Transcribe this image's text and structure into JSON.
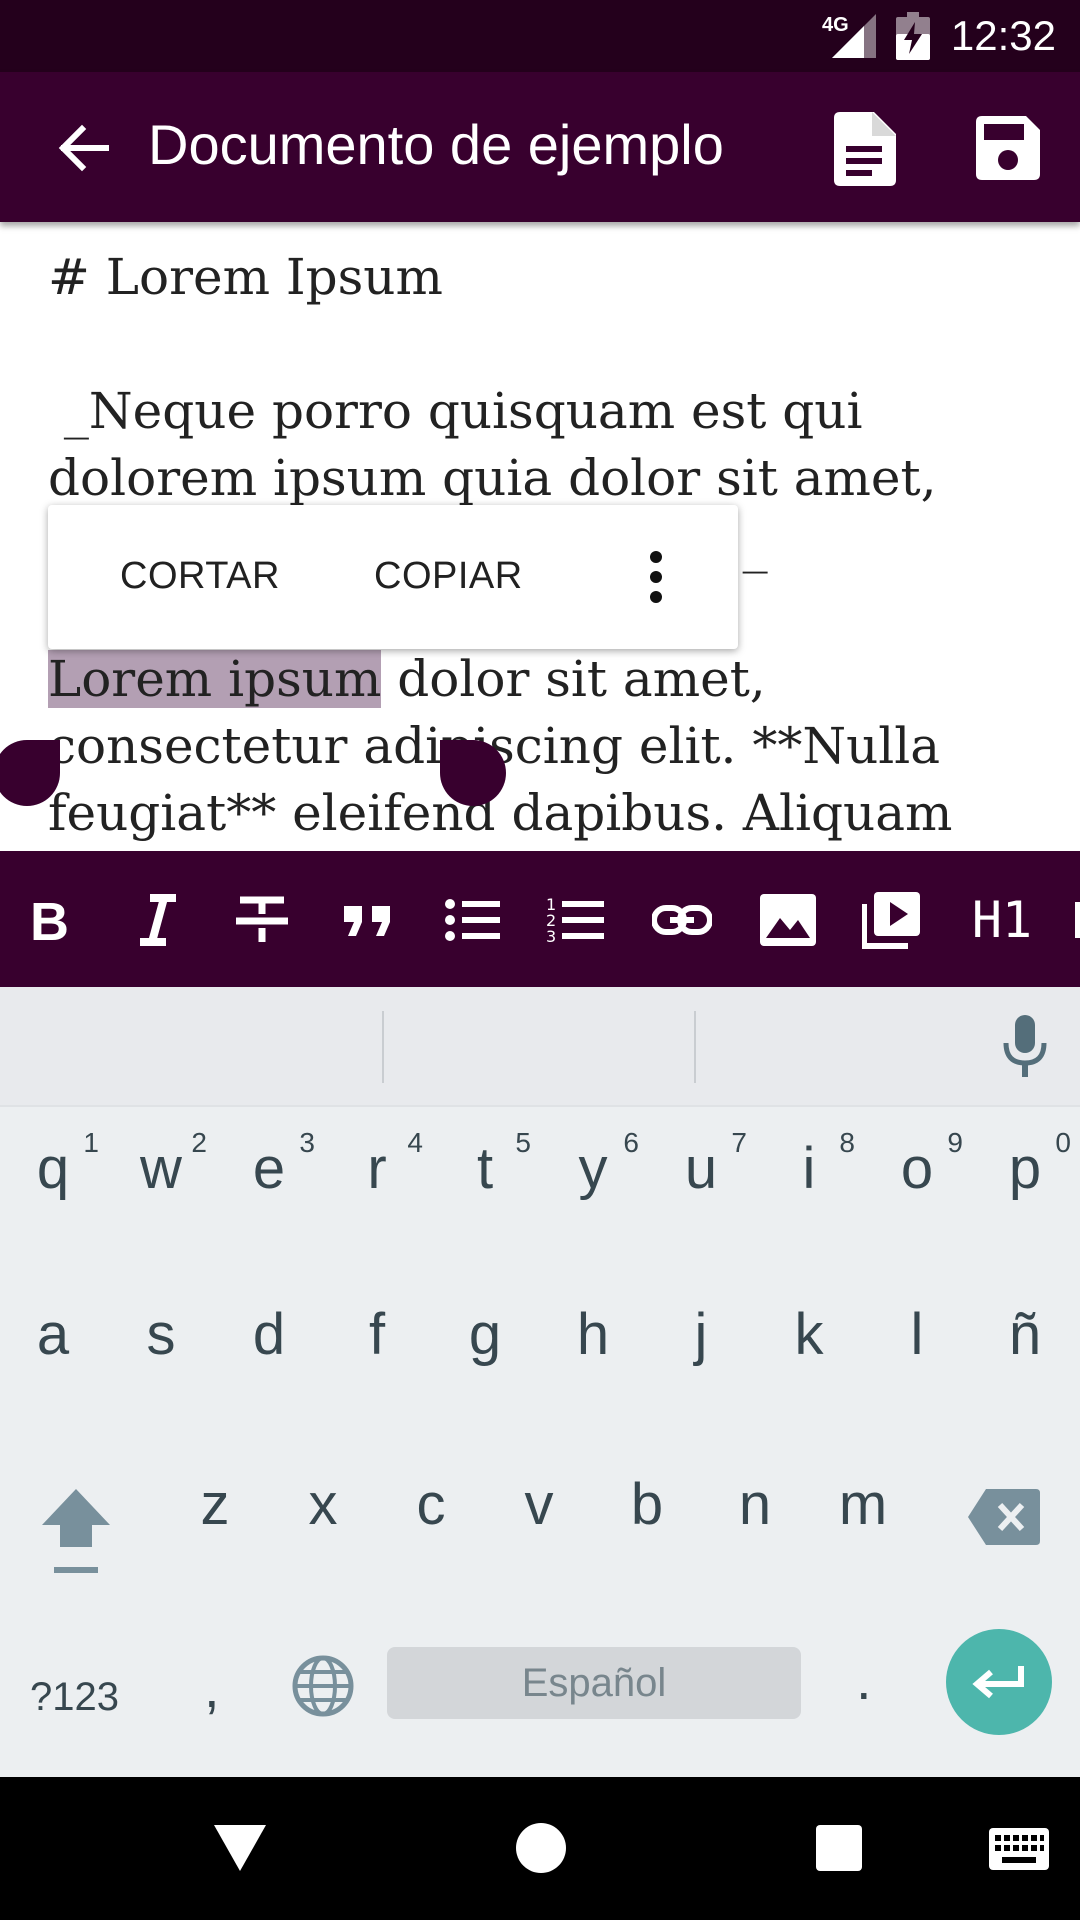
{
  "status_bar": {
    "time": "12:32",
    "network": "4G"
  },
  "app_bar": {
    "title": "Documento de ejemplo"
  },
  "editor": {
    "heading": "# Lorem Ipsum",
    "quote": " _Neque porro quisquam est qui dolorem ipsum quia dolor sit amet, consectetur, adipisci velit..._",
    "body_selected": "Lorem ipsum",
    "body_rest": " dolor sit amet, consectetur adipiscing elit. **Nulla feugiat** eleifend dapibus. Aliquam"
  },
  "context_menu": {
    "cut_label": "CORTAR",
    "copy_label": "COPIAR"
  },
  "format_toolbar": {
    "items": [
      "bold-icon",
      "italic-icon",
      "strikethrough-icon",
      "quote-icon",
      "bullet-list-icon",
      "numbered-list-icon",
      "link-icon",
      "image-icon",
      "video-icon"
    ],
    "heading_label": "H1"
  },
  "keyboard": {
    "row1": [
      {
        "ch": "q",
        "hint": "1"
      },
      {
        "ch": "w",
        "hint": "2"
      },
      {
        "ch": "e",
        "hint": "3"
      },
      {
        "ch": "r",
        "hint": "4"
      },
      {
        "ch": "t",
        "hint": "5"
      },
      {
        "ch": "y",
        "hint": "6"
      },
      {
        "ch": "u",
        "hint": "7"
      },
      {
        "ch": "i",
        "hint": "8"
      },
      {
        "ch": "o",
        "hint": "9"
      },
      {
        "ch": "p",
        "hint": "0"
      }
    ],
    "row2": [
      "a",
      "s",
      "d",
      "f",
      "g",
      "h",
      "j",
      "k",
      "l",
      "ñ"
    ],
    "row3": [
      "z",
      "x",
      "c",
      "v",
      "b",
      "n",
      "m"
    ],
    "symbols_label": "?123",
    "comma": ",",
    "space_label": "Español",
    "period": ".",
    "accent_color": "#4db6ac"
  },
  "colors": {
    "app_bar": "#38002e",
    "status_bar": "#24001c",
    "selection": "#b39fb3"
  }
}
